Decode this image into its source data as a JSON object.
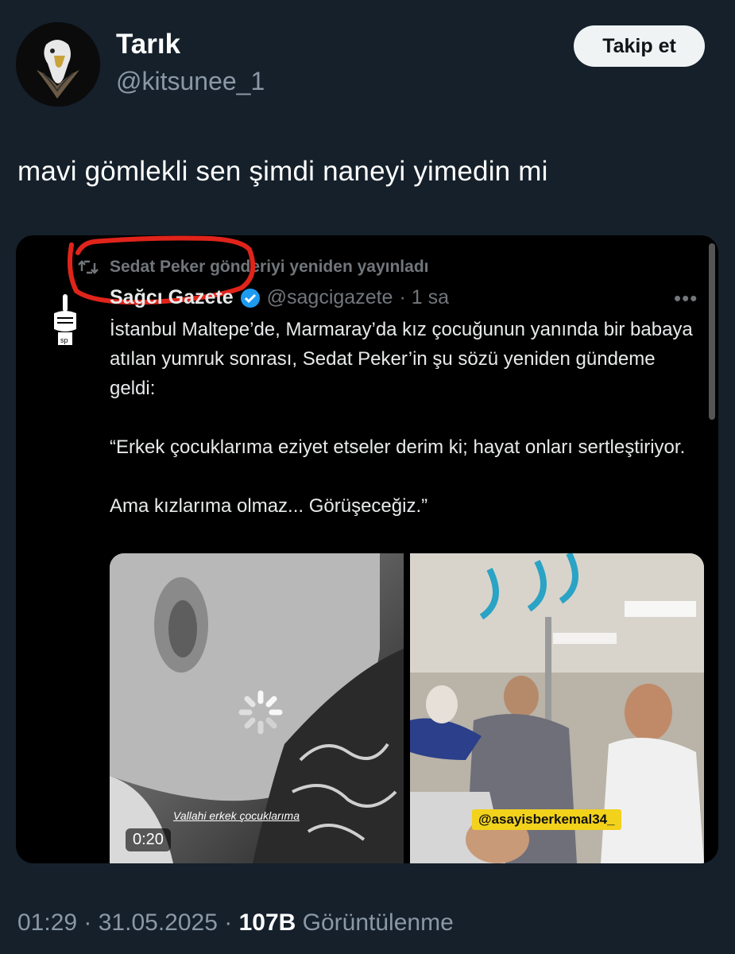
{
  "author": {
    "name": "Tarık",
    "handle": "@kitsunee_1",
    "avatar_icon": "eagle-avatar-icon"
  },
  "follow_button": {
    "label": "Takip et"
  },
  "tweet": {
    "text": "mavi gömlekli sen şimdi naneyi yimedin mi"
  },
  "embedded_post": {
    "repost_label": "Sedat Peker gönderiyi yeniden yayınladı",
    "account_name": "Sağcı Gazete",
    "verified_icon": "verified-badge-icon",
    "account_handle": "@sagcigazete",
    "time": "· 1 sa",
    "more_label": "•••",
    "body": "İstanbul Maltepe’de, Marmaray’da kız çocuğunun yanında bir babaya atılan yumruk sonrası, Sedat Peker’in şu sözü yeniden gündeme geldi:\n\n“Erkek çocuklarıma eziyet etseler derim ki; hayat onları sertleştiriyor.\n\nAma kızlarıma olmaz... Görüşeceğiz.”",
    "video_caption": "Vallahi erkek çocuklarıma",
    "video_time": "0:20",
    "watermark": "@asayisberkemal34_",
    "annotation_color": "#e0241b"
  },
  "meta": {
    "time": "01:29",
    "date": "31.05.2025",
    "views_count": "107B",
    "views_label": "Görüntülenme"
  },
  "colors": {
    "background": "#15202b",
    "secondary_text": "#8b98a5",
    "verified_blue": "#1d9bf0"
  }
}
